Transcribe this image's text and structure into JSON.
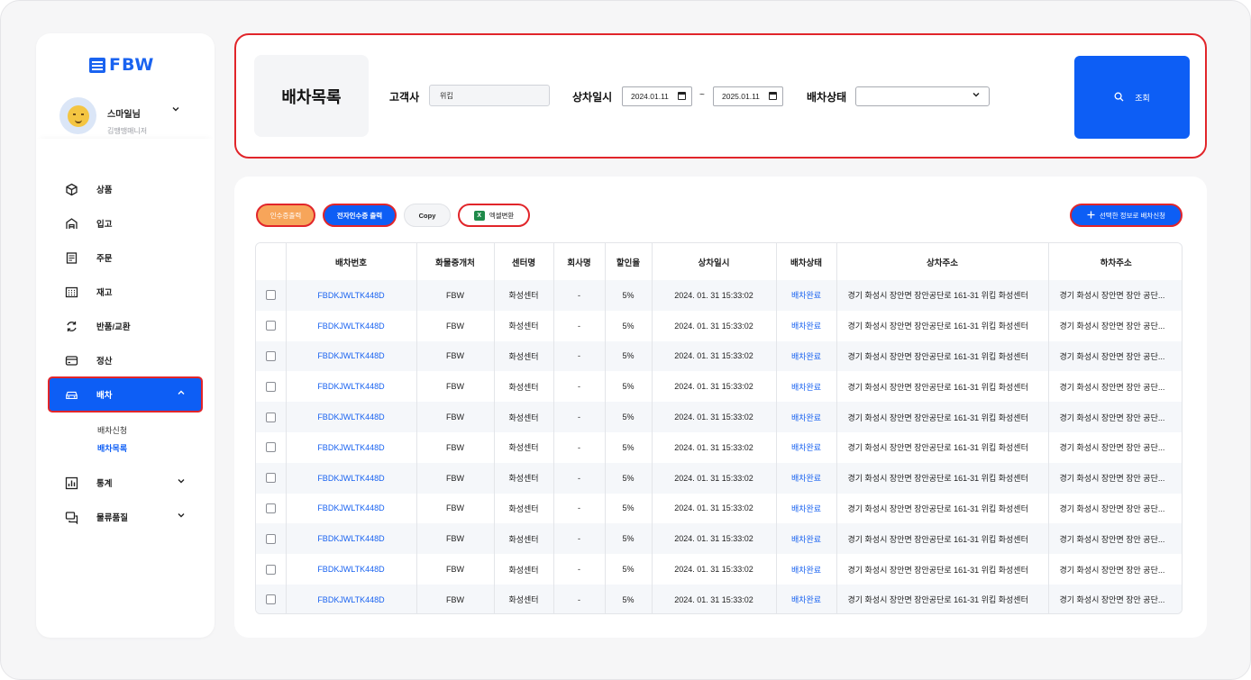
{
  "app": {
    "logo_text": "FBW"
  },
  "profile": {
    "name": "스마일님",
    "role": "김땡땡매니저",
    "icon": "smile-avatar"
  },
  "sidebar": {
    "items": [
      {
        "label": "상품",
        "icon": "box-icon"
      },
      {
        "label": "입고",
        "icon": "warehouse-icon"
      },
      {
        "label": "주문",
        "icon": "receipt-icon"
      },
      {
        "label": "재고",
        "icon": "grid-icon"
      },
      {
        "label": "반품/교환",
        "icon": "exchange-icon"
      },
      {
        "label": "정산",
        "icon": "card-icon"
      },
      {
        "label": "배차",
        "icon": "car-icon",
        "active": true
      },
      {
        "label": "통계",
        "icon": "chart-icon"
      },
      {
        "label": "물류품질",
        "icon": "chat-icon"
      }
    ],
    "submenu": [
      "배차신청",
      "배차목록"
    ],
    "submenu_current": "배차목록"
  },
  "filter": {
    "title": "배차목록",
    "customer_label": "고객사",
    "customer_value": "위킵",
    "date_label": "상차일시",
    "date_from": "2024.01.11",
    "date_sep": "~",
    "date_to": "2025.01.11",
    "status_label": "배차상태",
    "status_value": "",
    "search_label": "조회"
  },
  "actions": {
    "receipt": "인수증출력",
    "e_receipt": "전자인수증 출력",
    "copy": "Copy",
    "excel": "엑셀변환",
    "dispatch": "선택한 정보로 배차신청"
  },
  "table": {
    "headers": [
      "",
      "배차번호",
      "화물중개처",
      "센터명",
      "회사명",
      "할인율",
      "상차일시",
      "배차상태",
      "상차주소",
      "하차주소"
    ],
    "rows": [
      [
        "FBDKJWLTK448D",
        "FBW",
        "화성센터",
        "-",
        "5%",
        "2024. 01. 31 15:33:02",
        "배차완료",
        "경기 화성시 장안면 장안공단로 161-31 위킵 화성센터",
        "경기 화성시 장안면 장안 공단..."
      ],
      [
        "FBDKJWLTK448D",
        "FBW",
        "화성센터",
        "-",
        "5%",
        "2024. 01. 31 15:33:02",
        "배차완료",
        "경기 화성시 장안면 장안공단로 161-31 위킵 화성센터",
        "경기 화성시 장안면 장안 공단..."
      ],
      [
        "FBDKJWLTK448D",
        "FBW",
        "화성센터",
        "-",
        "5%",
        "2024. 01. 31 15:33:02",
        "배차완료",
        "경기 화성시 장안면 장안공단로 161-31 위킵 화성센터",
        "경기 화성시 장안면 장안 공단..."
      ],
      [
        "FBDKJWLTK448D",
        "FBW",
        "화성센터",
        "-",
        "5%",
        "2024. 01. 31 15:33:02",
        "배차완료",
        "경기 화성시 장안면 장안공단로 161-31 위킵 화성센터",
        "경기 화성시 장안면 장안 공단..."
      ],
      [
        "FBDKJWLTK448D",
        "FBW",
        "화성센터",
        "-",
        "5%",
        "2024. 01. 31 15:33:02",
        "배차완료",
        "경기 화성시 장안면 장안공단로 161-31 위킵 화성센터",
        "경기 화성시 장안면 장안 공단..."
      ],
      [
        "FBDKJWLTK448D",
        "FBW",
        "화성센터",
        "-",
        "5%",
        "2024. 01. 31 15:33:02",
        "배차완료",
        "경기 화성시 장안면 장안공단로 161-31 위킵 화성센터",
        "경기 화성시 장안면 장안 공단..."
      ],
      [
        "FBDKJWLTK448D",
        "FBW",
        "화성센터",
        "-",
        "5%",
        "2024. 01. 31 15:33:02",
        "배차완료",
        "경기 화성시 장안면 장안공단로 161-31 위킵 화성센터",
        "경기 화성시 장안면 장안 공단..."
      ],
      [
        "FBDKJWLTK448D",
        "FBW",
        "화성센터",
        "-",
        "5%",
        "2024. 01. 31 15:33:02",
        "배차완료",
        "경기 화성시 장안면 장안공단로 161-31 위킵 화성센터",
        "경기 화성시 장안면 장안 공단..."
      ],
      [
        "FBDKJWLTK448D",
        "FBW",
        "화성센터",
        "-",
        "5%",
        "2024. 01. 31 15:33:02",
        "배차완료",
        "경기 화성시 장안면 장안공단로 161-31 위킵 화성센터",
        "경기 화성시 장안면 장안 공단..."
      ],
      [
        "FBDKJWLTK448D",
        "FBW",
        "화성센터",
        "-",
        "5%",
        "2024. 01. 31 15:33:02",
        "배차완료",
        "경기 화성시 장안면 장안공단로 161-31 위킵 화성센터",
        "경기 화성시 장안면 장안 공단..."
      ],
      [
        "FBDKJWLTK448D",
        "FBW",
        "화성센터",
        "-",
        "5%",
        "2024. 01. 31 15:33:02",
        "배차완료",
        "경기 화성시 장안면 장안공단로 161-31 위킵 화성센터",
        "경기 화성시 장안면 장안 공단..."
      ]
    ]
  },
  "colors": {
    "accent": "#0d5ef5",
    "highlight_border": "#e1252a",
    "receipt_button": "#f7a55a",
    "link": "#1a63f0"
  }
}
